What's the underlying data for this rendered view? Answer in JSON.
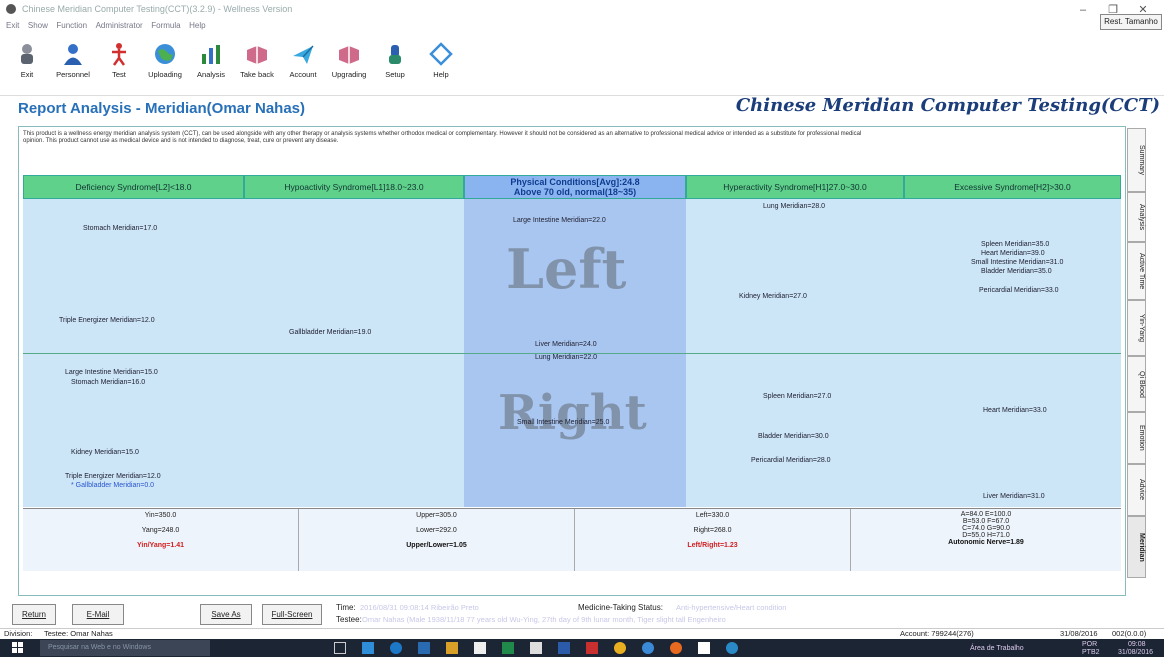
{
  "window": {
    "title": "Chinese Meridian Computer Testing(CCT)(3.2.9) - Wellness Version",
    "restore_tab": "Rest. Tamanho",
    "minimize": "–",
    "maximize": "❐",
    "close": "✕"
  },
  "menu": [
    "Exit",
    "Show",
    "Function",
    "Administrator",
    "Formula",
    "Help"
  ],
  "toolbar": [
    {
      "label": "Exit",
      "icon": "exit-icon"
    },
    {
      "label": "Personnel",
      "icon": "person-icon"
    },
    {
      "label": "Test",
      "icon": "acupuncture-figure-icon"
    },
    {
      "label": "Uploading",
      "icon": "globe-icon"
    },
    {
      "label": "Analysis",
      "icon": "bar-chart-icon"
    },
    {
      "label": "Take back",
      "icon": "book-icon"
    },
    {
      "label": "Account",
      "icon": "paper-plane-icon"
    },
    {
      "label": "Upgrading",
      "icon": "book-icon"
    },
    {
      "label": "Setup",
      "icon": "hand-icon"
    },
    {
      "label": "Help",
      "icon": "diamond-icon"
    }
  ],
  "report": {
    "title": "Report Analysis - Meridian(Omar Nahas)",
    "brand": "Chinese Meridian Computer Testing(CCT)",
    "disclaimer": "This product is a wellness energy meridian analysis system (CCT), can be used alongside with any other therapy or analysis systems whether orthodox medical or complementary. However it should not be considered as an alternative to professional medical advice or intended as a substitute for professional medical opinion. This product cannot use as medical device and is not intended to diagnose, treat, cure or prevent any disease.",
    "nav_prev": "<<",
    "nav_next": ">>"
  },
  "headers": [
    "Deficiency Syndrome[L2]<18.0",
    "Hypoactivity Syndrome[L1]18.0~23.0",
    "Physical Conditions[Avg]:24.8",
    "Above 70 old, normal(18~35)",
    "Hyperactivity Syndrome[H1]27.0~30.0",
    "Excessive Syndrome[H2]>30.0"
  ],
  "left_big": "Left",
  "right_big": "Right",
  "left_meridians": {
    "l2a": "Stomach Meridian=17.0",
    "l2b": "Triple Energizer Meridian=12.0",
    "l1a": "Gallbladder Meridian=19.0",
    "m1": "Large Intestine Meridian=22.0",
    "m2": "Liver Meridian=24.0",
    "h1a": "Lung Meridian=28.0",
    "h1b": "Kidney Meridian=27.0",
    "h2a": "Spleen Meridian=35.0",
    "h2b": "Heart Meridian=39.0",
    "h2c": "Small Intestine Meridian=31.0",
    "h2d": "Bladder Meridian=35.0",
    "h2e": "Pericardial Meridian=33.0"
  },
  "right_meridians": {
    "l2a": "Large Intestine Meridian=15.0",
    "l2b": "Stomach Meridian=16.0",
    "l2c": "Kidney Meridian=15.0",
    "l2d": "Triple Energizer Meridian=12.0",
    "l2e": "* Gallbladder Meridian=0.0",
    "m1": "Lung Meridian=22.0",
    "m2": "Small Intestine Meridian=25.0",
    "h1a": "Spleen Meridian=27.0",
    "h1b": "Bladder Meridian=30.0",
    "h1c": "Pericardial Meridian=28.0",
    "h2a": "Heart Meridian=33.0",
    "h2b": "Liver Meridian=31.0"
  },
  "bottom": {
    "yin": "Yin=350.0",
    "yang": "Yang=248.0",
    "yinyang": "Yin/Yang=1.41",
    "upper": "Upper=305.0",
    "lower": "Lower=292.0",
    "upperlower": "Upper/Lower=1.05",
    "left": "Left=330.0",
    "right": "Right=268.0",
    "leftright": "Left/Right=1.23",
    "a": "A=84.0  E=100.0",
    "b": "B=53.0  F=67.0",
    "c": "C=74.0  G=90.0",
    "d": "D=55.0  H=71.0",
    "autonomic": "Autonomic Nerve=1.89"
  },
  "side_tabs": [
    "Summary",
    "Analysis",
    "Active Time",
    "Yin-Yang",
    "Qi Blood",
    "Emotion",
    "Advice",
    "Meridian"
  ],
  "actions": {
    "return": "Return",
    "email": "E-Mail",
    "save": "Save As",
    "fullscreen": "Full-Screen"
  },
  "info": {
    "time_label": "Time:",
    "time_value": "2016/08/31 09:08:14 Ribeirão Preto",
    "status_label": "Medicine-Taking Status:",
    "status_value": "Anti-hypertensive/Heart condition",
    "tester_label": "Testee:",
    "tester_value": "Omar Nahas (Male 1938/11/18 77 years old Wu-Ying, 27th day of 9th lunar month, Tiger slight tall Engenheiro"
  },
  "statusbar": {
    "division": "Division:",
    "testee": "Testee: Omar Nahas",
    "account": "Account: 799244(276)",
    "date": "31/08/2016",
    "code": "002(0.0.0)"
  },
  "taskbar": {
    "search": "Pesquisar na Web e no Windows",
    "desktop": "Área de Trabalho",
    "lang": "POR",
    "layout": "PTB2",
    "time": "09:08",
    "date": "31/08/2016"
  },
  "colors": {
    "accent": "#2870b8",
    "green": "#5fd18a",
    "panel": "#cce6f8",
    "mid": "#a9c6f0",
    "alert": "#d02020"
  }
}
